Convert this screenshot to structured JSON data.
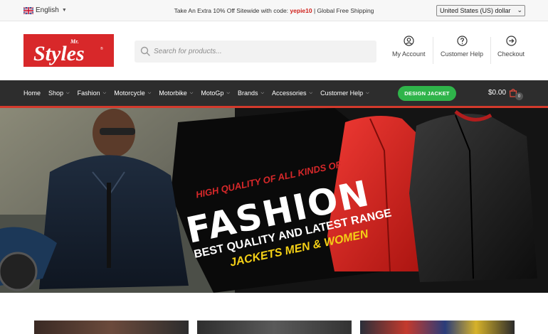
{
  "topbar": {
    "language": "English",
    "promo_prefix": "Take An Extra 10% Off Sitewide with code: ",
    "promo_code": "yepie10",
    "promo_suffix": " | Global Free Shipping",
    "currency": "United States (US) dollar"
  },
  "header": {
    "logo_main": "Styles",
    "logo_small": "Mr.",
    "search_placeholder": "Search for products...",
    "links": [
      {
        "label": "My Account",
        "icon": "user-icon"
      },
      {
        "label": "Customer Help",
        "icon": "help-icon"
      },
      {
        "label": "Checkout",
        "icon": "arrow-right-icon"
      }
    ]
  },
  "nav": {
    "items": [
      {
        "label": "Home",
        "has_dropdown": false
      },
      {
        "label": "Shop",
        "has_dropdown": true
      },
      {
        "label": "Fashion",
        "has_dropdown": true
      },
      {
        "label": "Motorcycle",
        "has_dropdown": true
      },
      {
        "label": "Motorbike",
        "has_dropdown": true
      },
      {
        "label": "MotoGp",
        "has_dropdown": true
      },
      {
        "label": "Brands",
        "has_dropdown": true
      },
      {
        "label": "Accessories",
        "has_dropdown": true
      },
      {
        "label": "Customer Help",
        "has_dropdown": true
      }
    ],
    "design_button": "DESIGN JACKET",
    "cart_total": "$0.00",
    "cart_count": "0"
  },
  "hero": {
    "line1": "HIGH QUALITY OF ALL KINDS OF",
    "line2": "FASHION",
    "line3": "BEST QUALITY AND LATEST RANGE",
    "line4": "JACKETS MEN & WOMEN"
  },
  "colors": {
    "brand_red": "#d8282a",
    "nav_bg": "#2d2d2d",
    "button_green": "#2fb44a",
    "promo_code_color": "#d0211c",
    "hero_accent_yellow": "#f4d016"
  }
}
